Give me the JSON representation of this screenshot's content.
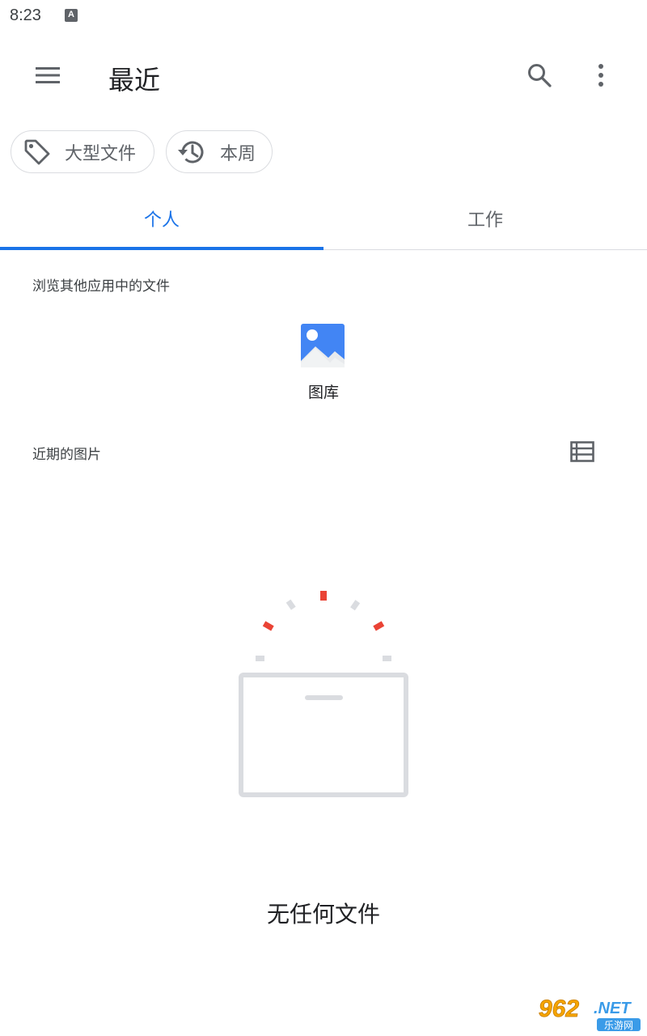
{
  "status_bar": {
    "time": "8:23",
    "notification_letter": "A"
  },
  "app_bar": {
    "title": "最近",
    "menu_icon": "menu-icon",
    "search_icon": "search-icon",
    "more_icon": "more-vert-icon"
  },
  "chips": [
    {
      "label": "大型文件",
      "icon": "tag-icon"
    },
    {
      "label": "本周",
      "icon": "history-icon"
    }
  ],
  "tabs": [
    {
      "label": "个人",
      "selected": true
    },
    {
      "label": "工作",
      "selected": false
    }
  ],
  "browse_section": {
    "title": "浏览其他应用中的文件",
    "apps": [
      {
        "label": "图库",
        "icon": "photo-gallery-icon"
      }
    ]
  },
  "recent_section": {
    "title": "近期的图片",
    "view_toggle_icon": "list-view-icon"
  },
  "empty_state": {
    "message": "无任何文件"
  },
  "watermark": {
    "text": "962.NET",
    "subtext": "乐游网"
  },
  "colors": {
    "accent": "#1a73e8",
    "text_primary": "#202124",
    "text_secondary": "#5f6368",
    "divider": "#dadce0",
    "illustration_red": "#ea4335",
    "illustration_gray": "#dadce0"
  }
}
